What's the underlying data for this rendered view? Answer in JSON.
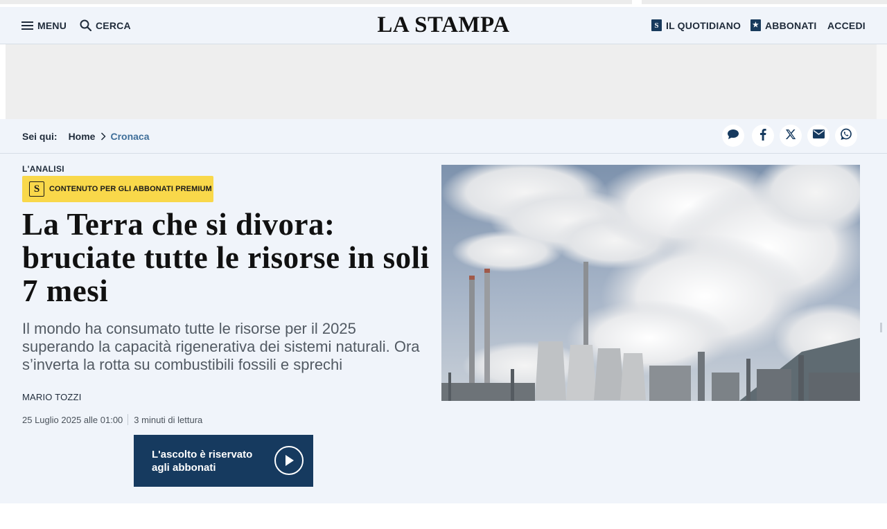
{
  "header": {
    "menu_label": "MENU",
    "search_label": "CERCA",
    "logo_text": "LA STAMPA",
    "quotidiano_label": "IL QUOTIDIANO",
    "abbonati_label": "ABBONATI",
    "accedi_label": "ACCEDI",
    "quotidiano_icon_glyph": "S",
    "abbonati_icon_glyph": "★"
  },
  "breadcrumb": {
    "prefix": "Sei qui:",
    "items": [
      "Home",
      "Cronaca"
    ]
  },
  "share": [
    "comment-icon",
    "facebook-icon",
    "x-icon",
    "email-icon",
    "whatsapp-icon"
  ],
  "article": {
    "kicker": "L'ANALISI",
    "premium_badge": "CONTENUTO PER GLI ABBONATI PREMIUM",
    "premium_icon_glyph": "S",
    "headline": "La Terra che si divora: bruciate tutte le risorse in soli 7 mesi",
    "standfirst": "Il mondo ha consumato tutte le risorse per il 2025 superando la capacità rigenerativa dei sistemi naturali. Ora s’inverta la rotta su combustibili fossili e sprechi",
    "author": "MARIO TOZZI",
    "date": "25 Luglio 2025 alle 01:00",
    "reading_time": "3 minuti di lettura",
    "listen_label": "L'ascolto è riservato agli abbonati"
  },
  "colors": {
    "brand_navy": "#163a5f",
    "premium_yellow": "#f9d84a",
    "page_bg": "#f0f4fa",
    "link_blue": "#3e6e99"
  }
}
